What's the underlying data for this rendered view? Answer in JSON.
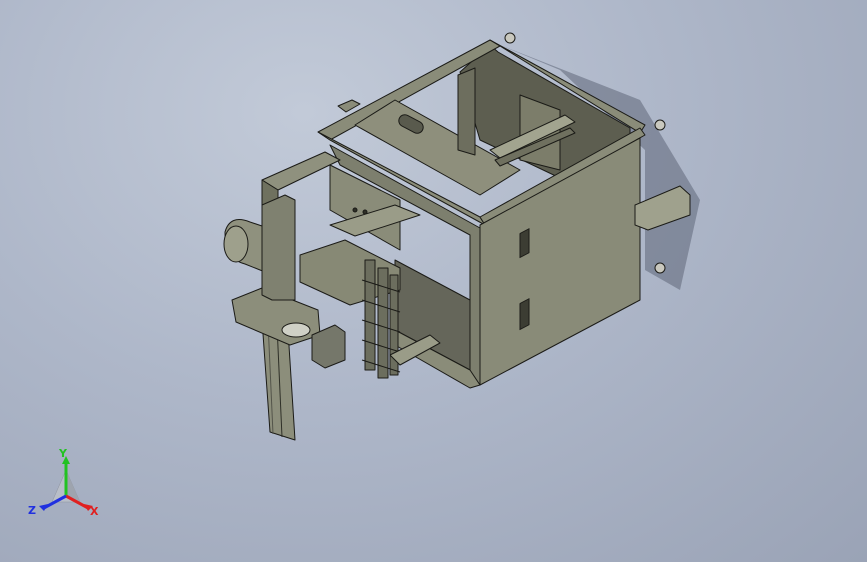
{
  "viewport": {
    "background_color": "#aeb7c9",
    "model_color": "#7d7f6e",
    "edge_color": "#1b1b17"
  },
  "triad": {
    "x_label": "X",
    "y_label": "Y",
    "z_label": "Z",
    "x_color": "#e02020",
    "y_color": "#22c222",
    "z_color": "#2030e0"
  }
}
